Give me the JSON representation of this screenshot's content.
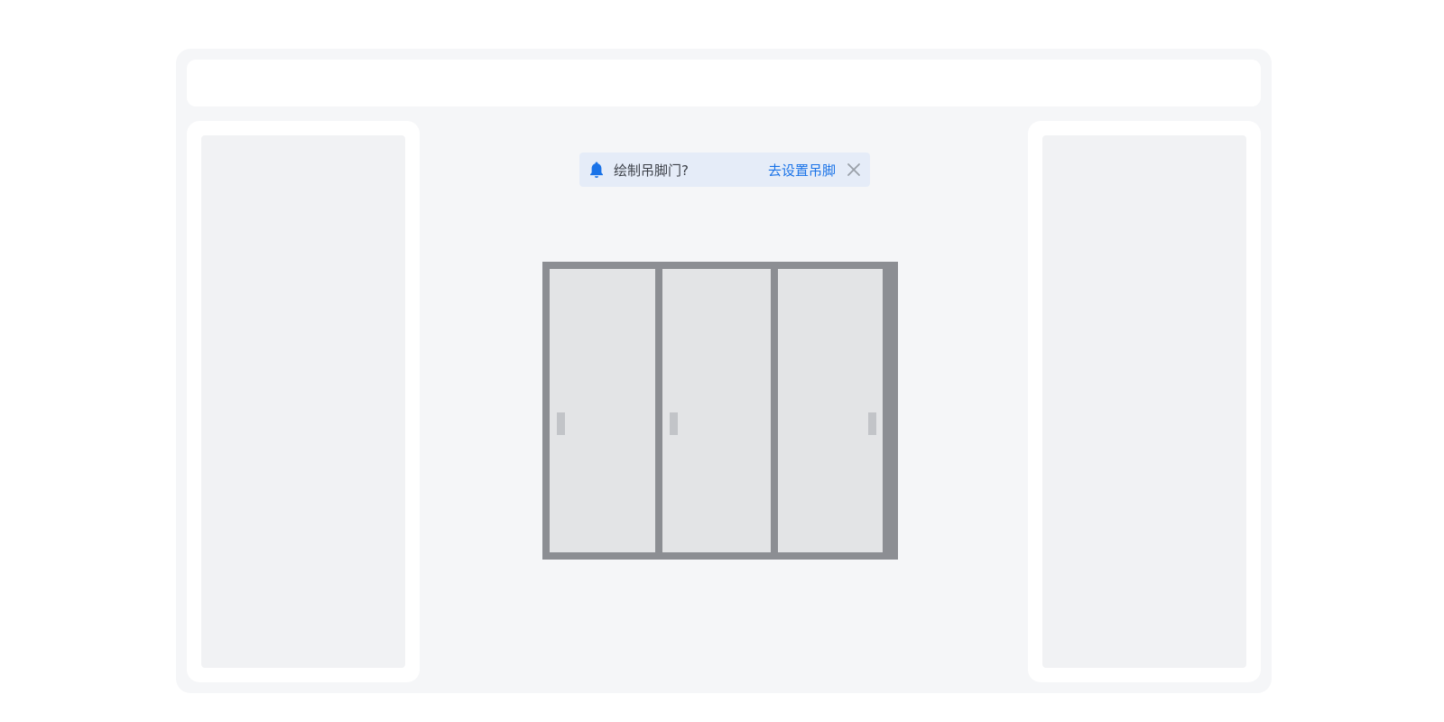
{
  "notice": {
    "icon": "bell-icon",
    "question": "绘制吊脚门?",
    "action_label": "去设置吊脚",
    "close_icon": "close-icon",
    "accent_color": "#1a73e8",
    "background_color": "#e5ecf8"
  },
  "door": {
    "panel_count": 3,
    "frame_color": "#8c8e93",
    "panel_color": "#e3e4e6",
    "handle_color": "#c2c4c8"
  }
}
